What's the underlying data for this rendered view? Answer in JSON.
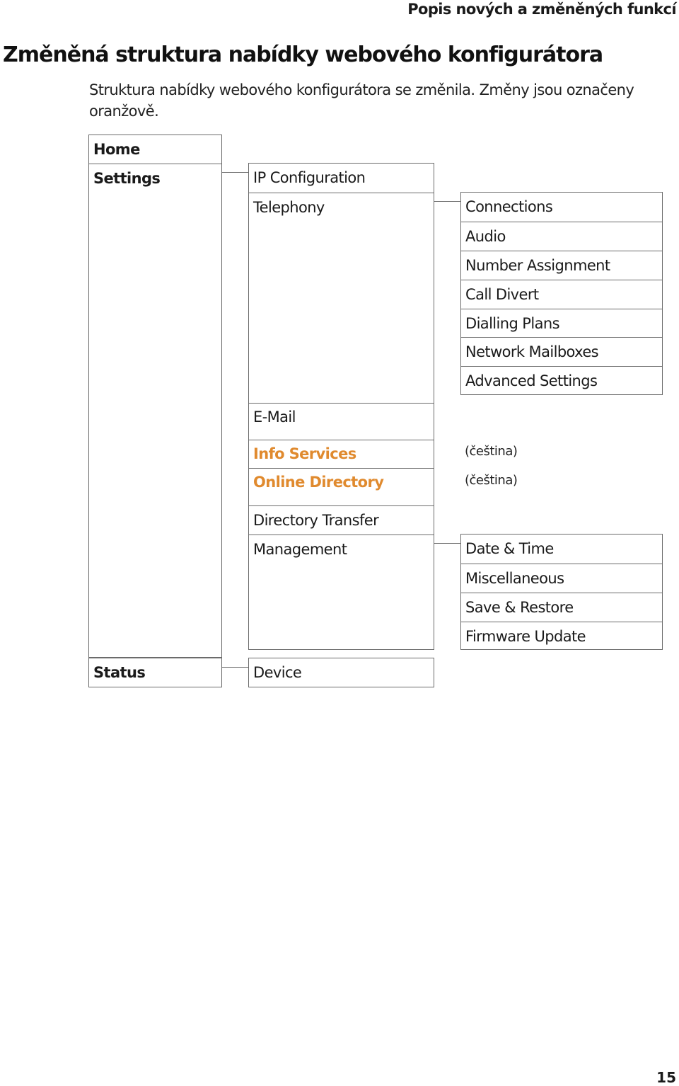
{
  "header": {
    "running_head": "Popis nových a změněných funkcí",
    "title": "Změněná struktura nabídky webového konfigurátora",
    "intro": "Struktura nabídky webového konfigurátora se změnila. Změny jsou označeny oranžově."
  },
  "colors": {
    "changed": "#e08a2e",
    "border": "#6b6b6b"
  },
  "menu": {
    "level1": {
      "home": "Home",
      "settings": "Settings",
      "status": "Status"
    },
    "settings": {
      "ip_configuration": "IP Configuration",
      "telephony": "Telephony",
      "email": "E-Mail",
      "info_services": "Info Services",
      "online_directory": "Online Directory",
      "directory_transfer": "Directory Transfer",
      "management": "Management"
    },
    "telephony": {
      "items": [
        "Connections",
        "Audio",
        "Number Assignment",
        "Call Divert",
        "Dialling Plans",
        "Network Mailboxes",
        "Advanced Settings"
      ]
    },
    "management": {
      "items": [
        "Date & Time",
        "Miscellaneous",
        "Save & Restore",
        "Firmware Update"
      ]
    },
    "status": {
      "device": "Device"
    },
    "notes": {
      "info_services": "(čeština)",
      "online_directory": "(čeština)"
    }
  },
  "footer": {
    "page_number": "15"
  }
}
